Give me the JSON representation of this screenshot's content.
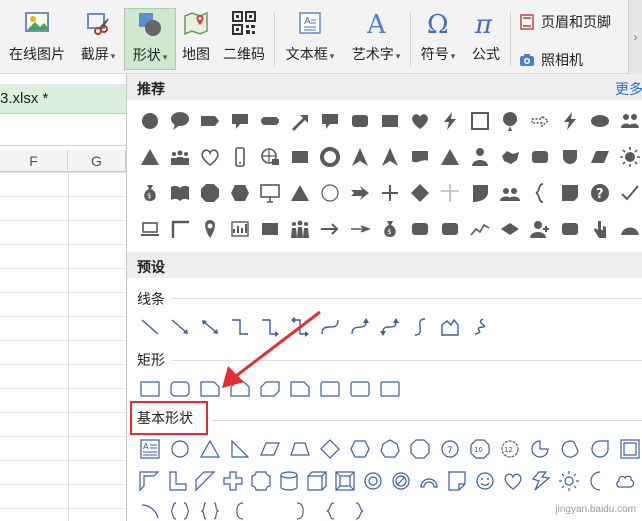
{
  "ribbon": {
    "buttons": [
      {
        "label": "在线图片",
        "icon": "online-image-icon"
      },
      {
        "label": "截屏",
        "icon": "screenshot-icon",
        "caret": true
      },
      {
        "label": "形状",
        "icon": "shapes-icon",
        "caret": true,
        "active": true
      },
      {
        "label": "地图",
        "icon": "map-icon"
      },
      {
        "label": "二维码",
        "icon": "qrcode-icon"
      },
      {
        "label": "文本框",
        "icon": "textbox-icon",
        "caret": true
      },
      {
        "label": "艺术字",
        "icon": "wordart-icon",
        "caret": true
      },
      {
        "label": "符号",
        "icon": "omega-icon",
        "caret": true
      },
      {
        "label": "公式",
        "icon": "pi-icon"
      }
    ],
    "header_footer": "页眉和页脚",
    "camera": "照相机",
    "caret_glyph": "▾",
    "scroll_glyph": "›"
  },
  "sheet": {
    "file_tab": "3.xlsx *",
    "columns": [
      "F",
      "G"
    ]
  },
  "panel": {
    "recommended": "推荐",
    "more": "更多",
    "preset": "预设",
    "lines": "线条",
    "rectangles": "矩形",
    "basic_shapes": "基本形状"
  },
  "colors": {
    "accent_green": "#cfe7cf",
    "shape_fill": "#5a5a5a",
    "outline_blue": "#3d5f9a",
    "highlight_red": "#e03030",
    "link_blue": "#1e6fd9"
  },
  "watermark": "jingyan.baidu.com"
}
